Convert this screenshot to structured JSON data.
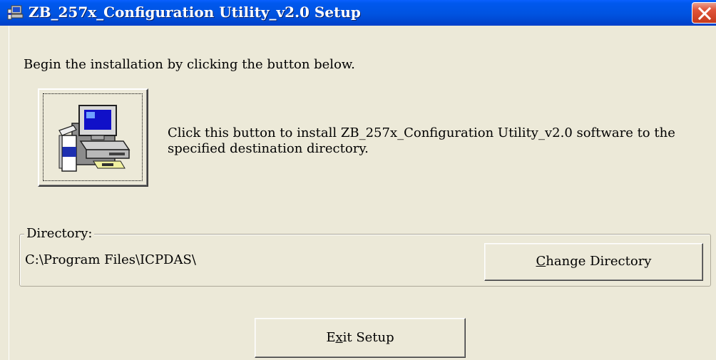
{
  "window": {
    "title": "ZB_257x_Configuration Utility_v2.0 Setup",
    "icon": "setup-computer-icon",
    "close_icon": "close-icon"
  },
  "main": {
    "instruction": "Begin the installation by clicking the button below.",
    "install_button_icon": "install-computer-icon",
    "install_description": "Click this button to install ZB_257x_Configuration Utility_v2.0 software to the specified destination directory."
  },
  "directory": {
    "group_label": "Directory:",
    "path": "C:\\Program Files\\ICPDAS\\",
    "change_button": {
      "prefix": "",
      "mnemonic": "C",
      "suffix": "hange Directory"
    }
  },
  "footer": {
    "exit_button": {
      "prefix": "E",
      "mnemonic": "x",
      "suffix": "it Setup"
    }
  },
  "colors": {
    "titlebar": "#0053e0",
    "dialog_bg": "#ece9d8",
    "close_button": "#e0553a"
  }
}
